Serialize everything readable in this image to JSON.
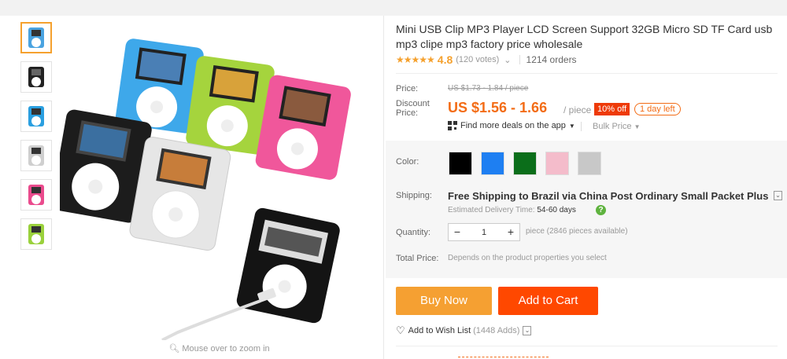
{
  "product": {
    "title": "Mini USB Clip MP3 Player LCD Screen Support 32GB Micro SD TF Card usb mp3 clipe mp3 factory price wholesale",
    "stars": "★★★★★",
    "rating": "4.8",
    "votes": "(120 votes)",
    "votes_dropdown": "⌄",
    "orders": "1214 orders"
  },
  "gallery": {
    "zoom_hint": "Mouse over to zoom in",
    "thumbnails": [
      {
        "color": "#4aa3e0"
      },
      {
        "color": "#222222"
      },
      {
        "color": "#2a9fe0"
      },
      {
        "color": "#cfcfcf"
      },
      {
        "color": "#ea4b8d"
      },
      {
        "color": "#9ad13c"
      }
    ]
  },
  "price": {
    "price_label": "Price:",
    "original": "US $1.73 - 1.84 / piece",
    "discount_label": "Discount Price:",
    "discount": "US $1.56 - 1.66",
    "per_piece": "/ piece",
    "off_badge": "10% off",
    "time_left": "1 day left",
    "app_deals": "Find more deals on the app",
    "bulk_price": "Bulk Price"
  },
  "options": {
    "color_label": "Color:",
    "colors": [
      "#000000",
      "#1e7ff2",
      "#0b6e1a",
      "#f4bccb",
      "#c8c8c8"
    ],
    "shipping_label": "Shipping:",
    "shipping_text": "Free Shipping to Brazil via China Post Ordinary Small Packet Plus",
    "est_label": "Estimated Delivery Time:",
    "est_days": "54-60 days",
    "qty_label": "Quantity:",
    "qty_minus": "−",
    "qty_value": "1",
    "qty_plus": "+",
    "qty_avail": "piece (2846 pieces available)",
    "total_label": "Total Price:",
    "total_note": "Depends on the product properties you select"
  },
  "actions": {
    "buy_now": "Buy Now",
    "add_to_cart": "Add to Cart",
    "wishlist": "Add to Wish List",
    "wish_adds": "(1448 Adds)"
  },
  "colors": {
    "accent_orange": "#f36c16",
    "buy_now_bg": "#f5a032",
    "cart_bg": "#ff4800",
    "star": "#f5a12e"
  }
}
